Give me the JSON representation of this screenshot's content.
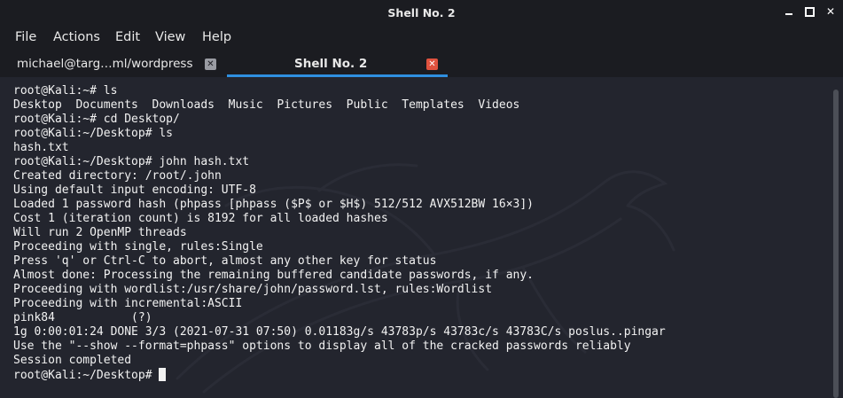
{
  "window": {
    "title": "Shell No. 2",
    "controls": {
      "minimize_icon": "minimize-icon",
      "maximize_icon": "maximize-icon",
      "close_glyph": "✕"
    }
  },
  "menu": [
    "File",
    "Actions",
    "Edit",
    "View",
    "Help"
  ],
  "tabs": [
    {
      "label": "michael@targ…ml/wordpress",
      "close_glyph": "✕",
      "active": false
    },
    {
      "label": "Shell No. 2",
      "close_glyph": "✕",
      "active": true
    }
  ],
  "terminal": {
    "lines": [
      "root@Kali:~# ls",
      "Desktop  Documents  Downloads  Music  Pictures  Public  Templates  Videos",
      "root@Kali:~# cd Desktop/",
      "root@Kali:~/Desktop# ls",
      "hash.txt",
      "root@Kali:~/Desktop# john hash.txt",
      "Created directory: /root/.john",
      "Using default input encoding: UTF-8",
      "Loaded 1 password hash (phpass [phpass ($P$ or $H$) 512/512 AVX512BW 16×3])",
      "Cost 1 (iteration count) is 8192 for all loaded hashes",
      "Will run 2 OpenMP threads",
      "Proceeding with single, rules:Single",
      "Press 'q' or Ctrl-C to abort, almost any other key for status",
      "Almost done: Processing the remaining buffered candidate passwords, if any.",
      "Proceeding with wordlist:/usr/share/john/password.lst, rules:Wordlist",
      "Proceeding with incremental:ASCII",
      "pink84           (?)",
      "1g 0:00:01:24 DONE 3/3 (2021-07-31 07:50) 0.01183g/s 43783p/s 43783c/s 43783C/s poslus..pingar",
      "Use the \"--show --format=phpass\" options to display all of the cracked passwords reliably",
      "Session completed"
    ],
    "prompt": "root@Kali:~/Desktop# "
  },
  "colors": {
    "background": "#23252e",
    "chrome": "#1b1c21",
    "text": "#f2f2f2",
    "active_tab_underline": "#2f8fe0",
    "active_tab_close": "#e0523f"
  }
}
